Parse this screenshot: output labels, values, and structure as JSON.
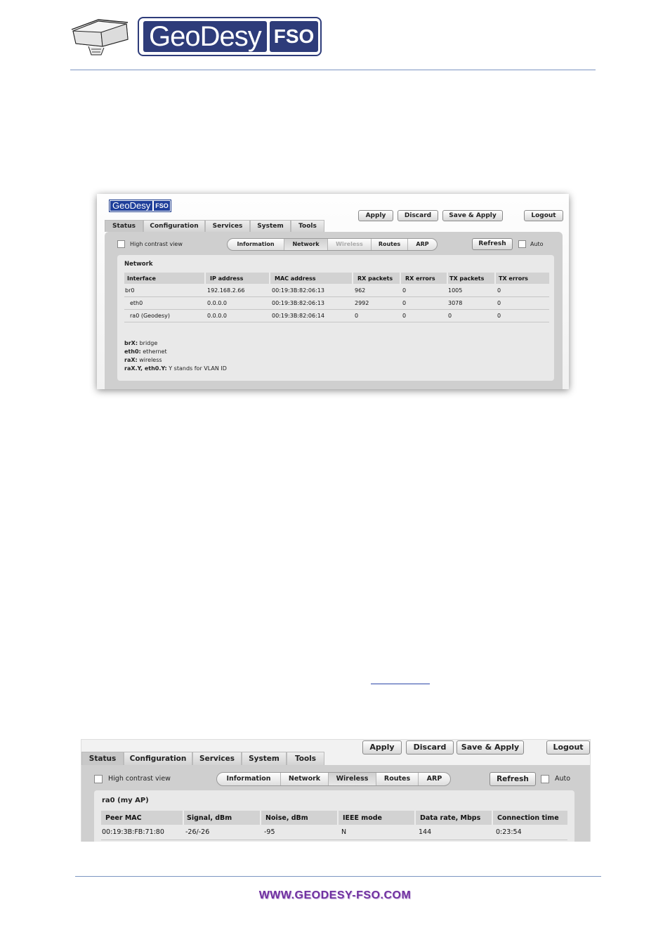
{
  "header": {
    "brand_main": "GeoDesy",
    "brand_suffix": "FSO"
  },
  "screen1": {
    "logo_main": "GeoDesy",
    "logo_suffix": "FSO",
    "buttons": {
      "apply": "Apply",
      "discard": "Discard",
      "save_apply": "Save & Apply",
      "logout": "Logout",
      "refresh": "Refresh"
    },
    "tabs": [
      "Status",
      "Configuration",
      "Services",
      "System",
      "Tools"
    ],
    "active_tab": "Status",
    "high_contrast": "High contrast view",
    "auto": "Auto",
    "subtabs": [
      "Information",
      "Network",
      "Wireless",
      "Routes",
      "ARP"
    ],
    "active_subtab": "Network",
    "section_title": "Network",
    "table": {
      "headers": [
        "Interface",
        "IP address",
        "MAC address",
        "RX packets",
        "RX errors",
        "TX packets",
        "TX errors"
      ],
      "rows": [
        [
          "br0",
          "192.168.2.66",
          "00:19:3B:82:06:13",
          "962",
          "0",
          "1005",
          "0"
        ],
        [
          "eth0",
          "0.0.0.0",
          "00:19:3B:82:06:13",
          "2992",
          "0",
          "3078",
          "0"
        ],
        [
          "ra0 (Geodesy)",
          "0.0.0.0",
          "00:19:3B:82:06:14",
          "0",
          "0",
          "0",
          "0"
        ]
      ]
    },
    "legend": [
      {
        "key": "brX:",
        "text": " bridge"
      },
      {
        "key": "eth0:",
        "text": " ethernet"
      },
      {
        "key": "raX:",
        "text": " wireless"
      },
      {
        "key": "raX.Y, eth0.Y:",
        "text": " Y stands for VLAN ID"
      }
    ]
  },
  "screen2": {
    "buttons": {
      "apply": "Apply",
      "discard": "Discard",
      "save_apply": "Save & Apply",
      "logout": "Logout",
      "refresh": "Refresh"
    },
    "tabs": [
      "Status",
      "Configuration",
      "Services",
      "System",
      "Tools"
    ],
    "active_tab": "Status",
    "high_contrast": "High contrast view",
    "auto": "Auto",
    "subtabs": [
      "Information",
      "Network",
      "Wireless",
      "Routes",
      "ARP"
    ],
    "active_subtab": "Wireless",
    "section_title": "ra0 (my AP)",
    "table": {
      "headers": [
        "Peer MAC",
        "Signal, dBm",
        "Noise, dBm",
        "IEEE mode",
        "Data rate, Mbps",
        "Connection time"
      ],
      "rows": [
        [
          "00:19:3B:FB:71:80",
          "-26/-26",
          "-95",
          "N",
          "144",
          "0:23:54"
        ]
      ]
    }
  },
  "footer": {
    "url": "WWW.GEODESY-FSO.COM"
  }
}
